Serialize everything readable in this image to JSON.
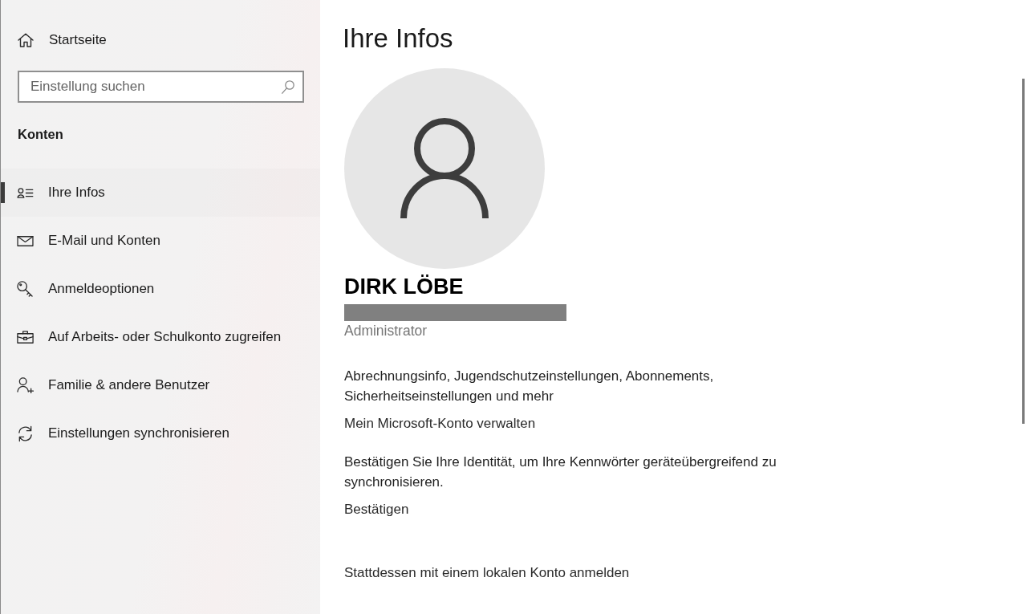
{
  "sidebar": {
    "home": {
      "label": "Startseite"
    },
    "search": {
      "placeholder": "Einstellung suchen"
    },
    "section_title": "Konten",
    "items": [
      {
        "label": "Ihre Infos",
        "selected": true
      },
      {
        "label": "E-Mail und Konten",
        "selected": false
      },
      {
        "label": "Anmeldeoptionen",
        "selected": false
      },
      {
        "label": "Auf Arbeits- oder Schulkonto zugreifen",
        "selected": false
      },
      {
        "label": "Familie & andere Benutzer",
        "selected": false
      },
      {
        "label": "Einstellungen synchronisieren",
        "selected": false
      }
    ]
  },
  "main": {
    "title": "Ihre Infos",
    "user": {
      "name": "DIRK LÖBE",
      "role": "Administrator"
    },
    "sections": [
      {
        "text": "Abrechnungsinfo, Jugendschutzeinstellungen, Abonnements, Sicherheitseinstellungen und mehr",
        "link": "Mein Microsoft-Konto verwalten"
      },
      {
        "text": "Bestätigen Sie Ihre Identität, um Ihre Kennwörter geräteübergreifend zu synchronisieren.",
        "link": "Bestätigen"
      }
    ],
    "bottom_link": "Stattdessen mit einem lokalen Konto anmelden"
  }
}
